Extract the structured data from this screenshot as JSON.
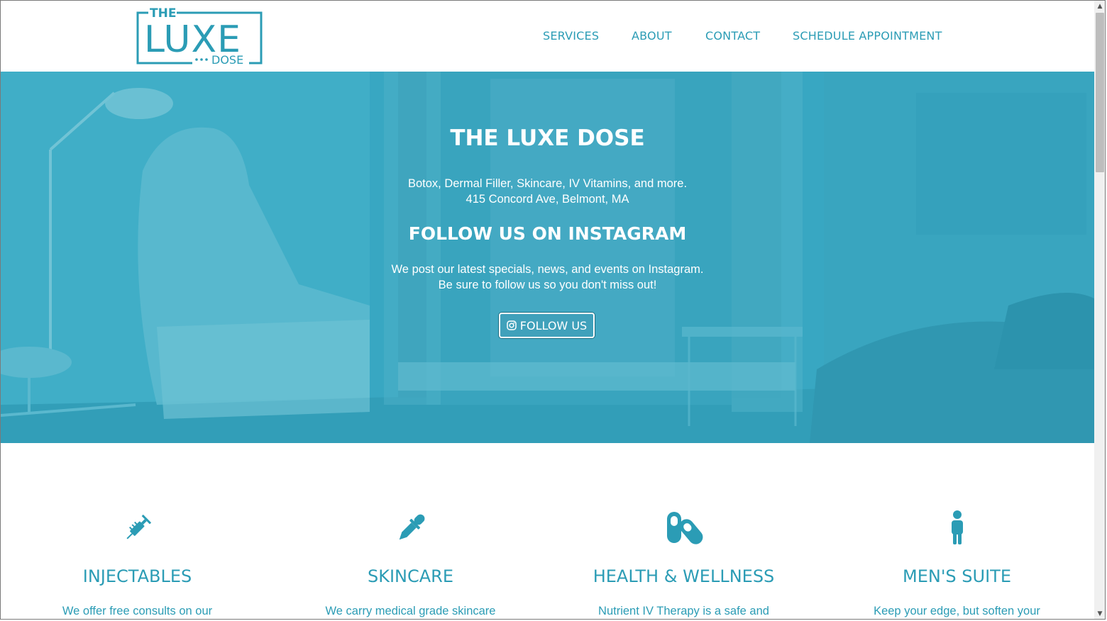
{
  "header": {
    "logo": {
      "top": "THE",
      "main": "LUXE",
      "bottom": "DOSE"
    },
    "nav": [
      {
        "label": "SERVICES"
      },
      {
        "label": "ABOUT"
      },
      {
        "label": "CONTACT"
      },
      {
        "label": "SCHEDULE APPOINTMENT"
      }
    ]
  },
  "hero": {
    "title": "THE LUXE DOSE",
    "tagline": "Botox, Dermal Filler, Skincare, IV Vitamins, and more.",
    "address": "415 Concord Ave, Belmont, MA",
    "instagram_heading": "FOLLOW US ON INSTAGRAM",
    "instagram_line1": "We post our latest specials, news, and events on Instagram.",
    "instagram_line2": "Be sure to follow us so you don't miss out!",
    "button_label": "FOLLOW US",
    "button_icon": "instagram-icon"
  },
  "services": [
    {
      "icon": "syringe-icon",
      "title": "INJECTABLES",
      "desc": "We offer free consults on our"
    },
    {
      "icon": "eyedropper-icon",
      "title": "SKINCARE",
      "desc": "We carry medical grade skincare"
    },
    {
      "icon": "pills-icon",
      "title": "HEALTH & WELLNESS",
      "desc": "Nutrient IV Therapy is a safe and"
    },
    {
      "icon": "person-icon",
      "title": "MEN'S SUITE",
      "desc": "Keep your edge, but soften your"
    }
  ],
  "colors": {
    "accent": "#2b9cb5",
    "hero_overlay": "#3aa8c3",
    "text_on_hero": "#ffffff"
  }
}
